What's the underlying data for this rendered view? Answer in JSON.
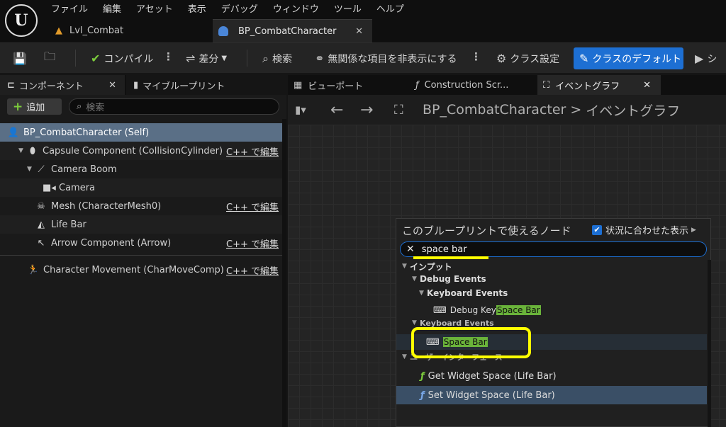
{
  "menu": [
    "ファイル",
    "編集",
    "アセット",
    "表示",
    "デバッグ",
    "ウィンドウ",
    "ツール",
    "ヘルプ"
  ],
  "doc_tabs": {
    "level": "Lvl_Combat",
    "blueprint": "BP_CombatCharacter"
  },
  "toolbar": {
    "compile": "コンパイル",
    "diff": "差分",
    "find": "検索",
    "hide_unrelated": "無関係な項目を非表示にする",
    "class_settings": "クラス設定",
    "class_defaults": "クラスのデフォルト",
    "simulate": "シ"
  },
  "left_panel": {
    "tab_components": "コンポーネント",
    "tab_my_blueprint": "マイブループリント",
    "add_button": "追加",
    "search_placeholder": "検索",
    "tree": [
      {
        "label": "BP_CombatCharacter (Self)",
        "icon": "character-icon"
      },
      {
        "label": "Capsule Component (CollisionCylinder)",
        "cpp": "C++ で編集",
        "icon": "capsule-icon"
      },
      {
        "label": "Camera Boom",
        "icon": "spring-arm-icon"
      },
      {
        "label": "Camera",
        "icon": "camera-icon"
      },
      {
        "label": "Mesh (CharacterMesh0)",
        "cpp": "C++ で編集",
        "icon": "skeleton-icon"
      },
      {
        "label": "Life Bar",
        "icon": "widget-icon"
      },
      {
        "label": "Arrow Component (Arrow)",
        "cpp": "C++ で編集",
        "icon": "arrow-icon"
      },
      {
        "label": "Character Movement (CharMoveComp)",
        "cpp": "C++ で編集",
        "icon": "movement-icon"
      }
    ]
  },
  "graph": {
    "tab_viewport": "ビューポート",
    "tab_construction": "Construction Scr...",
    "tab_event_graph": "イベントグラフ",
    "breadcrumb_bp": "BP_CombatCharacter",
    "breadcrumb_sep": ">",
    "breadcrumb_graph": "イベントグラフ"
  },
  "context_menu": {
    "title": "このブループリントで使えるノード",
    "context_sensitive": "状況に合わせた表示",
    "search_value": "space bar",
    "cat_input": "インプット",
    "cat_debug_events": "Debug Events",
    "cat_keyboard_events_1": "Keyboard Events",
    "item_debug_key_prefix": "Debug Key ",
    "item_match": "Space Bar",
    "cat_keyboard_events_2": "Keyboard Events",
    "cat_user_interface": "ユーザーインターフェース",
    "item_get_widget_space": "Get Widget Space (Life Bar)",
    "item_set_widget_space": "Set Widget Space (Life Bar)"
  }
}
